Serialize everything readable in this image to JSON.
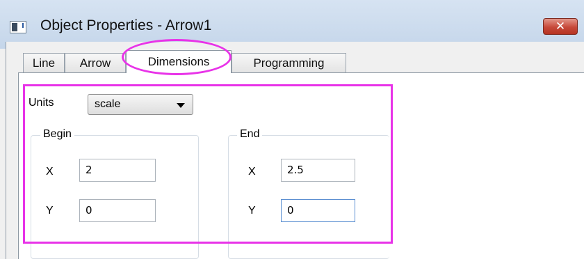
{
  "window": {
    "title": "Object Properties - Arrow1",
    "close_glyph": "✕"
  },
  "tabs": [
    {
      "label": "Line",
      "selected": false
    },
    {
      "label": "Arrow",
      "selected": false
    },
    {
      "label": "Dimensions",
      "selected": true
    },
    {
      "label": "Programming",
      "selected": false
    }
  ],
  "units": {
    "label": "Units",
    "selected_value": "scale"
  },
  "begin": {
    "legend": "Begin",
    "x_label": "X",
    "x_value": "2",
    "y_label": "Y",
    "y_value": "0"
  },
  "end": {
    "legend": "End",
    "x_label": "X",
    "x_value": "2.5",
    "y_label": "Y",
    "y_value": "0"
  },
  "colors": {
    "annotation": "#e833e8",
    "title_bar": "#c5d6ea",
    "close_button": "#c7493a"
  },
  "icons": [
    "app-icon",
    "close-icon",
    "dropdown-arrow-icon"
  ]
}
